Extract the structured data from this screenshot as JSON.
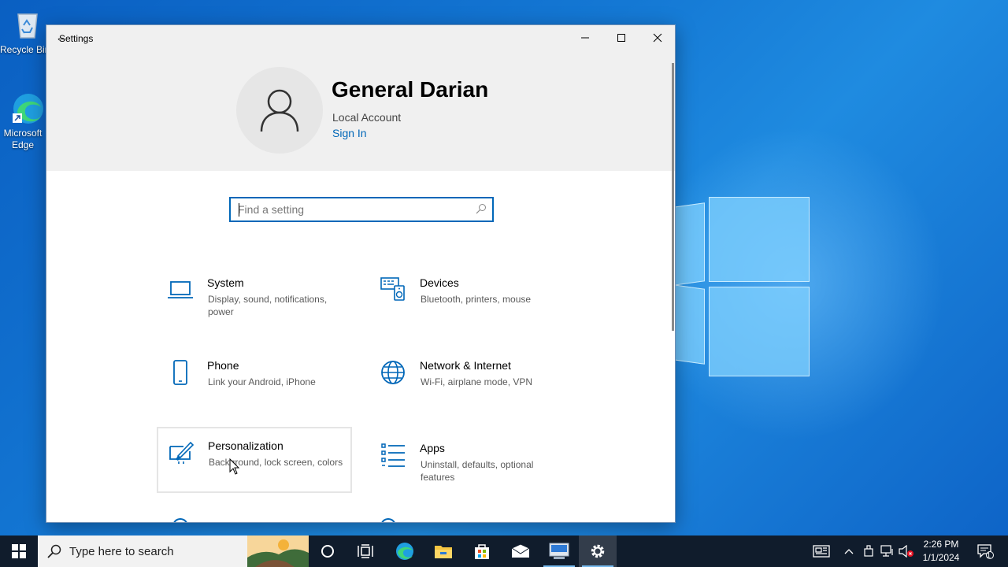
{
  "desktop": {
    "icons": [
      {
        "label": "Recycle Bin"
      },
      {
        "label": "Microsoft Edge"
      }
    ]
  },
  "window": {
    "title": "Settings",
    "back_glyph": "←",
    "controls": [
      "minimize-icon",
      "maximize-icon",
      "close-icon"
    ]
  },
  "account": {
    "name": "General Darian",
    "type": "Local Account",
    "sign_in": "Sign In"
  },
  "search": {
    "placeholder": "Find a setting",
    "value": ""
  },
  "categories": [
    {
      "name": "System",
      "desc": "Display, sound, notifications, power",
      "icon": "laptop-icon"
    },
    {
      "name": "Devices",
      "desc": "Bluetooth, printers, mouse",
      "icon": "devices-icon"
    },
    {
      "name": "Phone",
      "desc": "Link your Android, iPhone",
      "icon": "phone-icon"
    },
    {
      "name": "Network & Internet",
      "desc": "Wi-Fi, airplane mode, VPN",
      "icon": "globe-icon"
    },
    {
      "name": "Personalization",
      "desc": "Background, lock screen, colors",
      "icon": "paintbrush-icon"
    },
    {
      "name": "Apps",
      "desc": "Uninstall, defaults, optional features",
      "icon": "apps-list-icon"
    }
  ],
  "taskbar": {
    "search_placeholder": "Type here to search",
    "time": "2:26 PM",
    "date": "1/1/2024",
    "notification_count": "1"
  },
  "colors": {
    "accent": "#0067b8",
    "taskbar": "#101c2c",
    "header_bg": "#f0f0f0"
  }
}
